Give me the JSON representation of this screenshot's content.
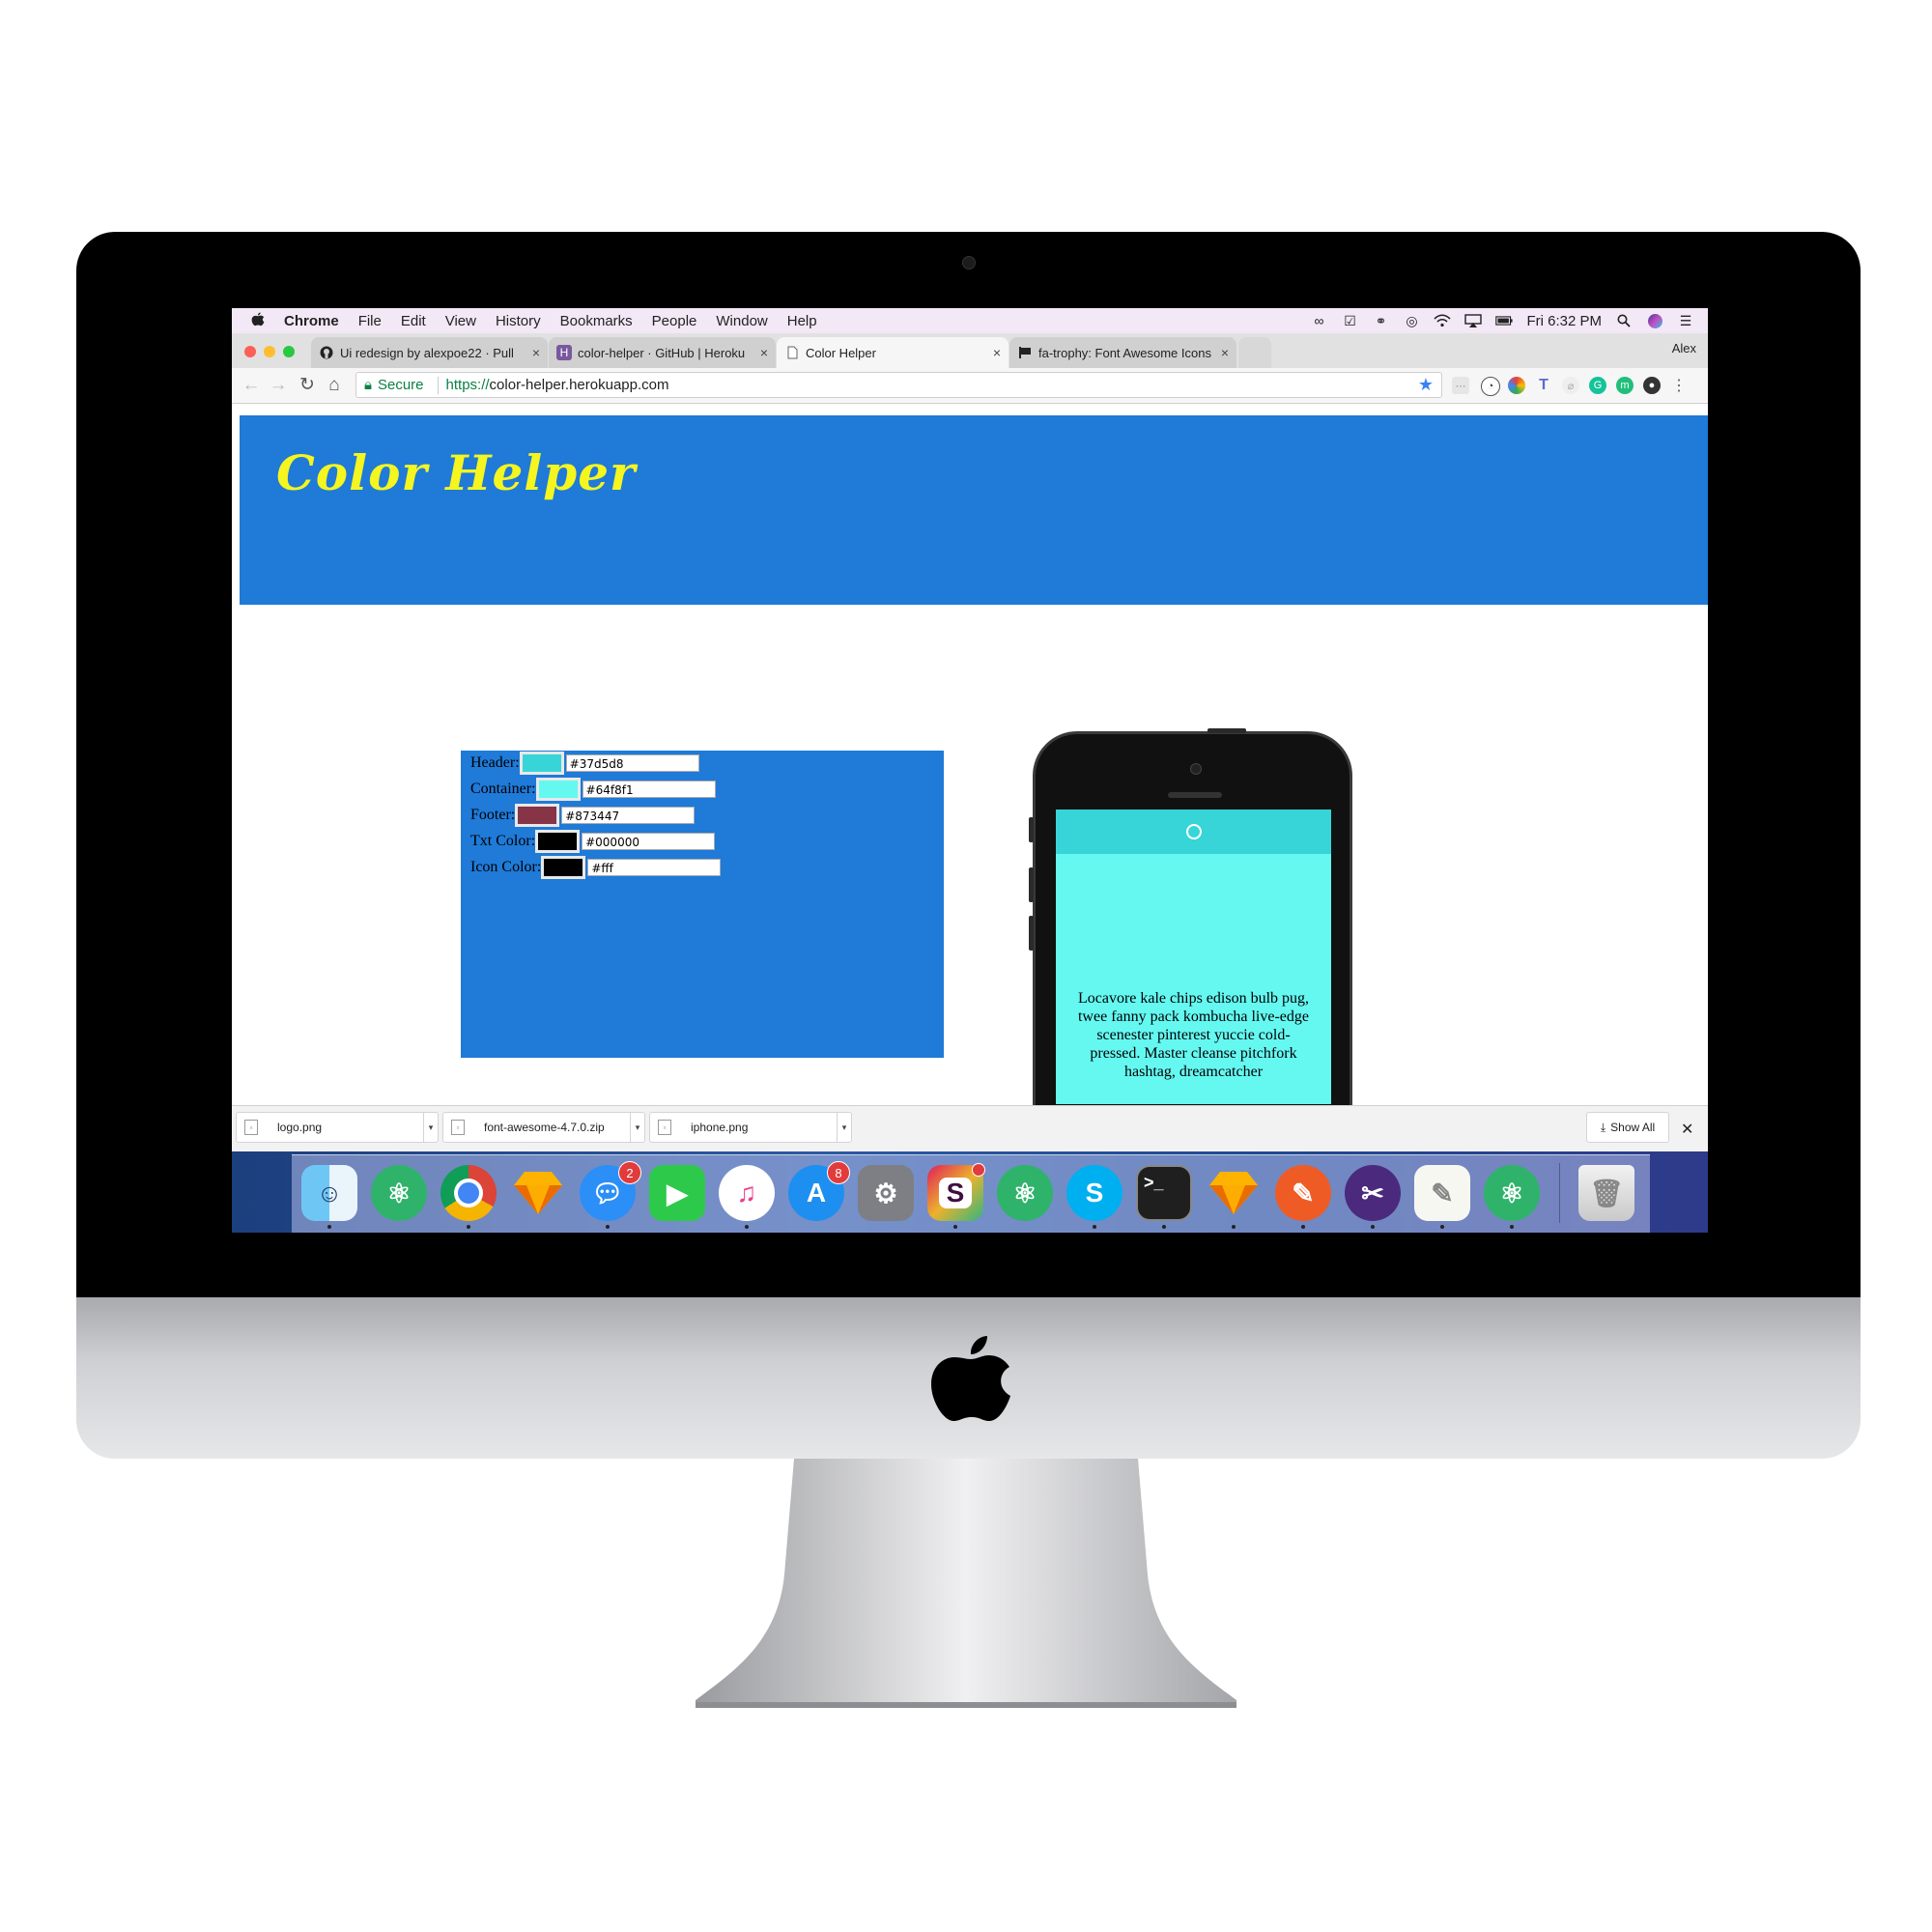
{
  "menubar": {
    "app_name": "Chrome",
    "items": [
      "File",
      "Edit",
      "View",
      "History",
      "Bookmarks",
      "People",
      "Window",
      "Help"
    ],
    "clock": "Fri 6:32 PM"
  },
  "tabs": [
    {
      "title": "Ui redesign by alexpoe22 · Pull",
      "favicon": "github-icon"
    },
    {
      "title": "color-helper · GitHub | Heroku",
      "favicon": "heroku-icon"
    },
    {
      "title": "Color Helper",
      "favicon": "page-icon"
    },
    {
      "title": "fa-trophy: Font Awesome Icons",
      "favicon": "font-awesome-icon"
    }
  ],
  "profile_name": "Alex",
  "omnibox": {
    "secure_label": "Secure",
    "scheme": "https://",
    "host": "color-helper.herokuapp.com"
  },
  "site": {
    "title": "Color Helper"
  },
  "colors": {
    "header": "#37d5d8",
    "container": "#64f8f1",
    "footer": "#873447",
    "text": "#000000",
    "icon": "#fff",
    "site_header": "#1f7ad8",
    "title_yellow": "#f5f520"
  },
  "controls": [
    {
      "label": "Header:",
      "value": "#37d5d8"
    },
    {
      "label": "Container:",
      "value": "#64f8f1"
    },
    {
      "label": "Footer:",
      "value": "#873447"
    },
    {
      "label": "Txt Color:",
      "value": "#000000"
    },
    {
      "label": "Icon Color:",
      "value": "#fff"
    }
  ],
  "phone": {
    "icon": "user-circle-icon",
    "text": "Locavore kale chips edison bulb pug, twee fanny pack kombucha live-edge scenester pinterest yuccie cold-pressed. Master cleanse pitchfork hashtag, dreamcatcher"
  },
  "downloads": {
    "files": [
      "logo.png",
      "font-awesome-4.7.0.zip",
      "iphone.png"
    ],
    "show_all_label": "Show All"
  },
  "dock": {
    "badges": {
      "messages": "2",
      "app_store": "8"
    }
  }
}
